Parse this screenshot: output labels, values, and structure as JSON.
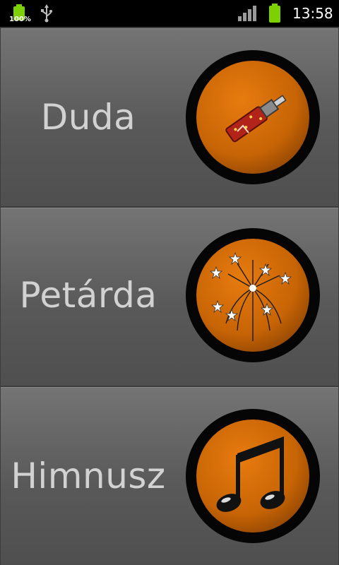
{
  "statusbar": {
    "battery_percent": "100%",
    "time": "13:58",
    "icons": [
      "battery-charging-icon",
      "usb-icon",
      "signal-icon",
      "battery-icon"
    ]
  },
  "items": [
    {
      "label": "Duda",
      "icon": "horn-icon"
    },
    {
      "label": "Petárda",
      "icon": "firework-icon"
    },
    {
      "label": "Himnusz",
      "icon": "music-note-icon"
    }
  ],
  "colors": {
    "accent": "#d06a08",
    "row_bg": "#5f5f5f",
    "label": "#d2d2d2",
    "ring": "#050505"
  }
}
